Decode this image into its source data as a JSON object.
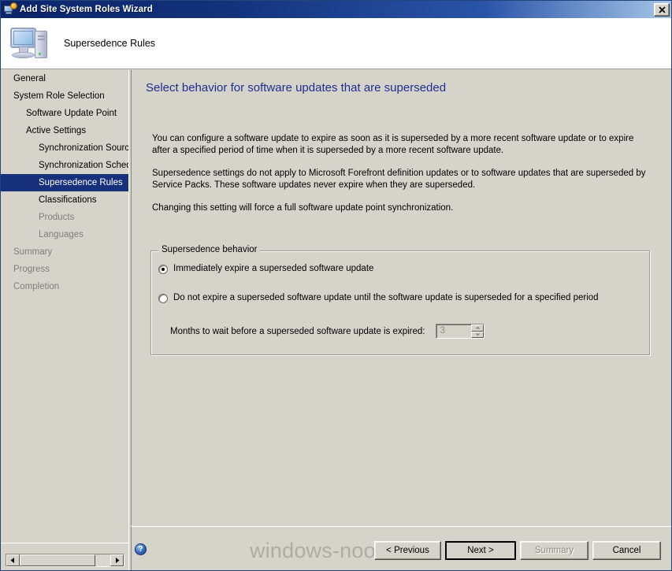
{
  "window": {
    "title": "Add Site System Roles Wizard",
    "title_icon": "server-gear-icon",
    "close_label": "close-icon"
  },
  "header": {
    "icon": "computer-icon",
    "title": "Supersedence Rules"
  },
  "sidebar": {
    "items": [
      {
        "label": "General",
        "level": 1,
        "state": "normal"
      },
      {
        "label": "System Role Selection",
        "level": 1,
        "state": "normal"
      },
      {
        "label": "Software Update Point",
        "level": 2,
        "state": "normal"
      },
      {
        "label": "Active Settings",
        "level": 2,
        "state": "normal"
      },
      {
        "label": "Synchronization Source",
        "level": 3,
        "state": "normal"
      },
      {
        "label": "Synchronization Schedule",
        "level": 3,
        "state": "normal"
      },
      {
        "label": "Supersedence Rules",
        "level": 3,
        "state": "selected"
      },
      {
        "label": "Classifications",
        "level": 3,
        "state": "normal"
      },
      {
        "label": "Products",
        "level": 3,
        "state": "dim"
      },
      {
        "label": "Languages",
        "level": 3,
        "state": "dim"
      },
      {
        "label": "Summary",
        "level": 1,
        "state": "dim"
      },
      {
        "label": "Progress",
        "level": 1,
        "state": "dim"
      },
      {
        "label": "Completion",
        "level": 1,
        "state": "dim"
      }
    ],
    "scrollbar": {
      "left_arrow": "chevron-left-icon",
      "right_arrow": "chevron-right-icon"
    }
  },
  "content": {
    "heading": "Select behavior for software updates that are superseded",
    "paragraphs": [
      "You can configure a software update to expire as soon as it is superseded by a more recent software update or to expire after a specified period of time when it is superseded by a more recent software update.",
      "Supersedence settings do not apply to Microsoft Forefront definition updates or to software updates that are superseded by Service Packs. These software updates never expire when they are superseded.",
      "Changing this setting will force a full software update point synchronization."
    ],
    "groupbox": {
      "legend": "Supersedence behavior",
      "options": [
        {
          "label": "Immediately expire a superseded software update",
          "selected": true
        },
        {
          "label": "Do not expire a superseded software update until the software update is superseded for a specified period",
          "selected": false
        }
      ],
      "months_label": "Months to wait before a superseded software update is expired:",
      "months_value": "3",
      "months_enabled": false
    }
  },
  "footer": {
    "help_icon": "help-icon",
    "help_glyph": "?",
    "watermark": "windows-noob.com",
    "buttons": [
      {
        "label": "< Previous",
        "state": "normal"
      },
      {
        "label": "Next >",
        "state": "default"
      },
      {
        "label": "Summary",
        "state": "disabled"
      },
      {
        "label": "Cancel",
        "state": "normal"
      }
    ]
  },
  "colors": {
    "titlebar": "#0a246a",
    "face": "#d6d3cb",
    "heading": "#1f2f8f",
    "selection": "#16307c",
    "disabled_text": "#8e8b84",
    "watermark": "#b0aca3"
  }
}
